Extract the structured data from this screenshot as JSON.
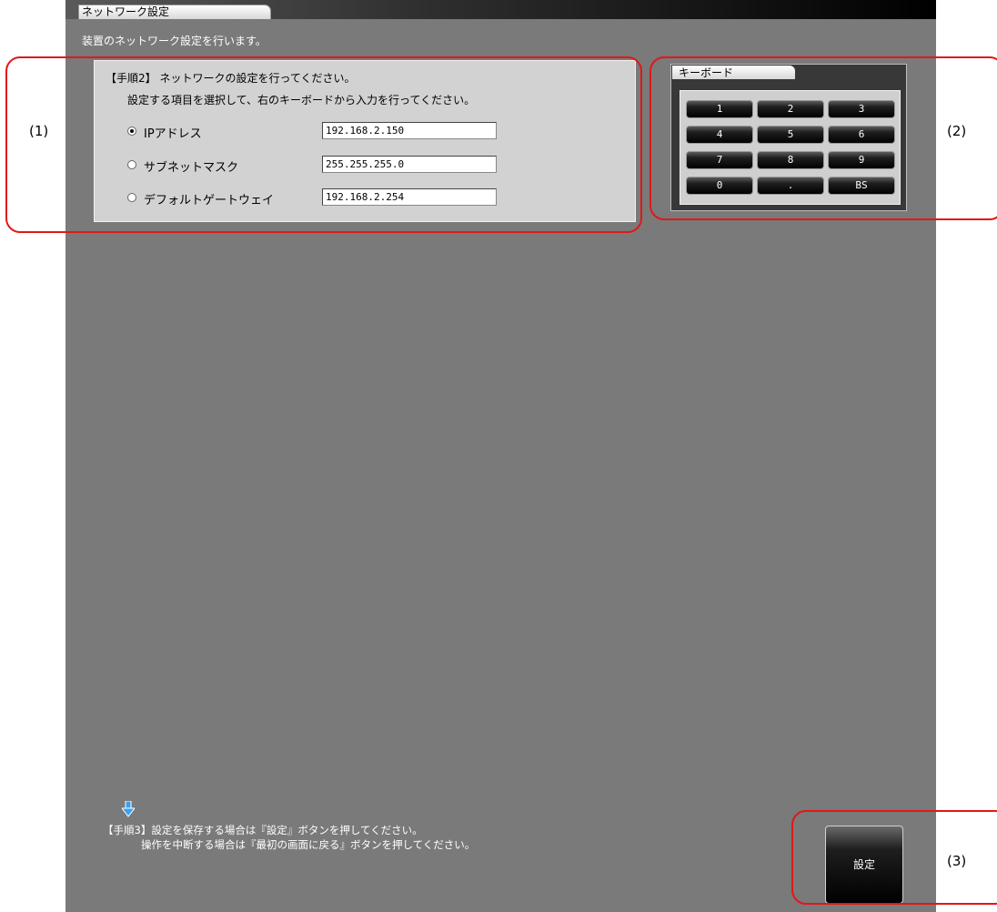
{
  "window": {
    "tab_title": "ネットワーク設定",
    "subtitle": "装置のネットワーク設定を行います。"
  },
  "step2": {
    "title": "【手順2】 ネットワークの設定を行ってください。",
    "description": "設定する項目を選択して、右のキーボードから入力を行ってください。",
    "fields": [
      {
        "label": "IPアドレス",
        "value": "192.168.2.150",
        "selected": true
      },
      {
        "label": "サブネットマスク",
        "value": "255.255.255.0",
        "selected": false
      },
      {
        "label": "デフォルトゲートウェイ",
        "value": "192.168.2.254",
        "selected": false
      }
    ]
  },
  "keyboard": {
    "title": "キーボード",
    "keys": [
      "1",
      "2",
      "3",
      "4",
      "5",
      "6",
      "7",
      "8",
      "9",
      "0",
      ".",
      "BS"
    ]
  },
  "step3": {
    "line1": "【手順3】設定を保存する場合は『設定』ボタンを押してください。",
    "line2": "操作を中断する場合は『最初の画面に戻る』ボタンを押してください。"
  },
  "set_button_label": "設定",
  "callouts": [
    "(1)",
    "(2)",
    "(3)"
  ],
  "colors": {
    "background": "#7a7a7a",
    "panel": "#d2d2d2",
    "callout": "#e01818",
    "arrow": "#3aa0f0"
  }
}
